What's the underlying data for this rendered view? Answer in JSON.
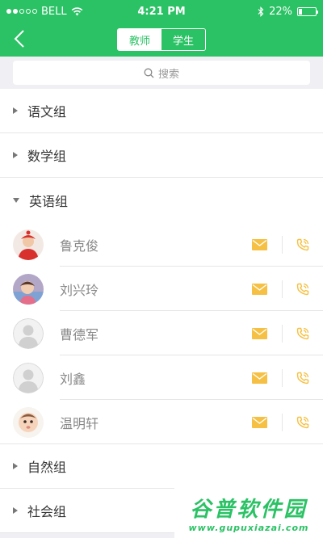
{
  "status_bar": {
    "carrier": "BELL",
    "time": "4:21 PM",
    "battery": "22%",
    "battery_level": 0.22
  },
  "nav": {
    "tabs": [
      {
        "label": "教师",
        "active": true
      },
      {
        "label": "学生",
        "active": false
      }
    ]
  },
  "search": {
    "placeholder": "搜索"
  },
  "groups": [
    {
      "name": "语文组",
      "expanded": false
    },
    {
      "name": "数学组",
      "expanded": false
    },
    {
      "name": "英语组",
      "expanded": true,
      "members": [
        "鲁克俊",
        "刘兴玲",
        "曹德军",
        "刘鑫",
        "温明轩"
      ]
    },
    {
      "name": "自然组",
      "expanded": false
    },
    {
      "name": "社会组",
      "expanded": false
    }
  ],
  "watermark": {
    "title": "谷普软件园",
    "url": "www.gupuxiazai.com"
  },
  "colors": {
    "accent": "#2bc265",
    "icon": "#f5c043"
  }
}
